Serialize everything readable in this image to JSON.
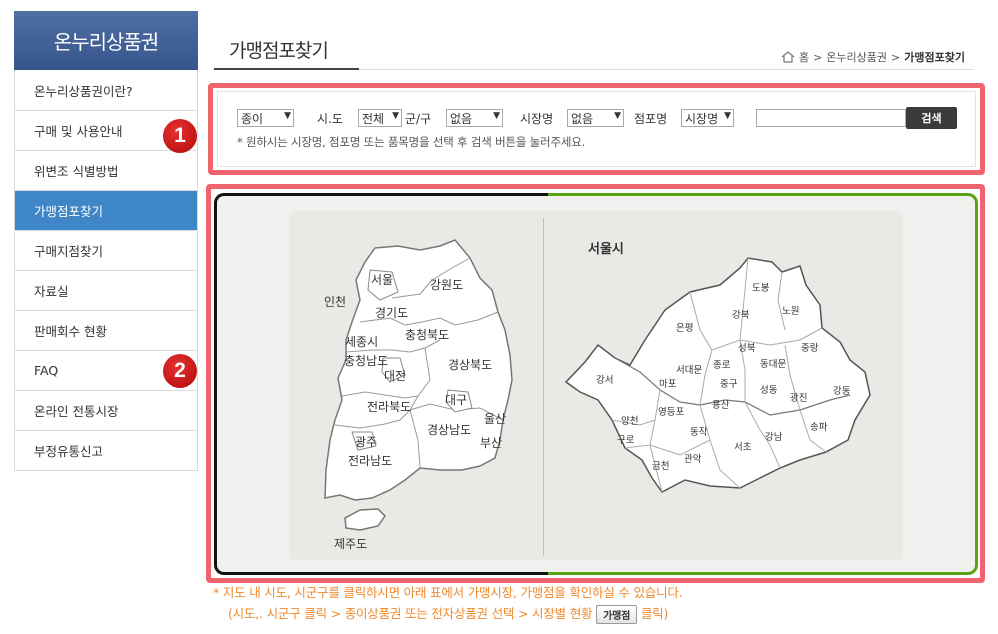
{
  "sidebar": {
    "brand": "온누리상품권",
    "items": [
      {
        "label": "온누리상품권이란?"
      },
      {
        "label": "구매 및 사용안내"
      },
      {
        "label": "위변조 식별방법"
      },
      {
        "label": "가맹점포찾기",
        "active": true
      },
      {
        "label": "구매지점찾기"
      },
      {
        "label": "자료실"
      },
      {
        "label": "판매회수 현황"
      },
      {
        "label": "FAQ"
      },
      {
        "label": "온라인 전통시장"
      },
      {
        "label": "부정유통신고"
      }
    ]
  },
  "header": {
    "title": "가맹점포찾기",
    "breadcrumb": {
      "home": "홈",
      "sep": ">",
      "parent": "온누리상품권",
      "current": "가맹점포찾기"
    }
  },
  "search": {
    "type_select": "종이",
    "sido_label": "시.도",
    "sido_select": "전체",
    "gungu_label": "군/구",
    "gungu_select": "없음",
    "market_label": "시장명",
    "market_select": "없음",
    "store_label": "점포명",
    "store_select": "시장명",
    "query_value": "",
    "button": "검색",
    "hint": "* 원하시는 시장명, 점포명 또는 품목명을 선택 후 검색 버튼을 눌러주세요."
  },
  "badges": {
    "one": "1",
    "two": "2"
  },
  "map": {
    "korea_regions": [
      "서울",
      "인천",
      "강원도",
      "경기도",
      "충청북도",
      "세종시",
      "충청남도",
      "대전",
      "경상북도",
      "대구",
      "전라북도",
      "울산",
      "경상남도",
      "광주",
      "부산",
      "전라남도",
      "제주도"
    ],
    "seoul_title": "서울시",
    "seoul_districts": [
      "도봉",
      "노원",
      "강북",
      "은평",
      "성북",
      "중랑",
      "종로",
      "동대문",
      "서대문",
      "강서",
      "마포",
      "중구",
      "성동",
      "광진",
      "강동",
      "용산",
      "영등포",
      "양천",
      "구로",
      "동작",
      "송파",
      "강남",
      "서초",
      "금천",
      "관악"
    ]
  },
  "notes": {
    "line1": "* 지도 내 시도, 시군구를 클릭하시면 아래 표에서 가맹시장, 가맹점을 확인하실 수 있습니다.",
    "line2_prefix": "(시도,. 시군구 클릭 > 종이상품권 또는 전자상품권 선택 > 시장별 현황",
    "line2_button": "가맹점",
    "line2_suffix": "클릭)"
  },
  "colors": {
    "accent_blue": "#3f86c7",
    "highlight_red": "#f06470",
    "note_orange": "#f08a2d",
    "map_green": "#5aa516"
  }
}
